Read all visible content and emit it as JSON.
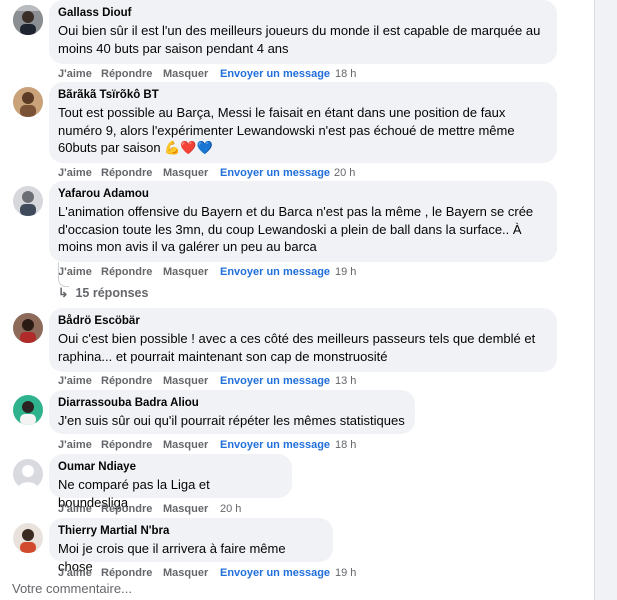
{
  "actions": {
    "like": "J'aime",
    "reply": "Répondre",
    "hide": "Masquer",
    "send_message": "Envoyer un message"
  },
  "comments": [
    {
      "author": "Gallass Diouf",
      "text": "Oui bien sûr il est l'un des meilleurs joueurs du monde il est capable de marquée au moins 40 buts par saison pendant 4 ans",
      "time": "18 h"
    },
    {
      "author": "Bãrãkã Tsïrõkô BT",
      "text": "Tout est possible au Barça, Messi le faisait en étant dans une position de faux numéro 9, alors l'expérimenter Lewandowski n'est pas échoué de mettre même 60buts par saison 💪❤️💙",
      "time": "20 h"
    },
    {
      "author": "Yafarou Adamou",
      "text": "L'animation offensive du Bayern et du Barca n'est pas la même , le Bayern se crée d'occasion toute les 3mn, du coup Lewandoski a plein de ball dans la surface.. À moins mon avis il va galérer un peu au barca",
      "time": "19 h"
    },
    {
      "author": "Bådrö Escöbär",
      "text": "Oui c'est bien possible ! avec a ces côté des meilleurs passeurs tels que demblé et raphina... et pourrait maintenant son cap de monstruosité",
      "time": "13 h"
    },
    {
      "author": "Diarrassouba Badra Aliou",
      "text": "J'en suis sûr oui qu'il pourrait répéter les mêmes statistiques",
      "time": "18 h"
    },
    {
      "author": "Oumar Ndiaye",
      "text": "Ne comparé pas la Liga et boundesliga",
      "time": "20 h"
    },
    {
      "author": "Thierry Martial N'bra",
      "text": "Moi je crois que il arrivera à faire même chose",
      "time": "19 h"
    }
  ],
  "replies_label": "15 réponses",
  "composer_placeholder": "Votre commentaire..."
}
